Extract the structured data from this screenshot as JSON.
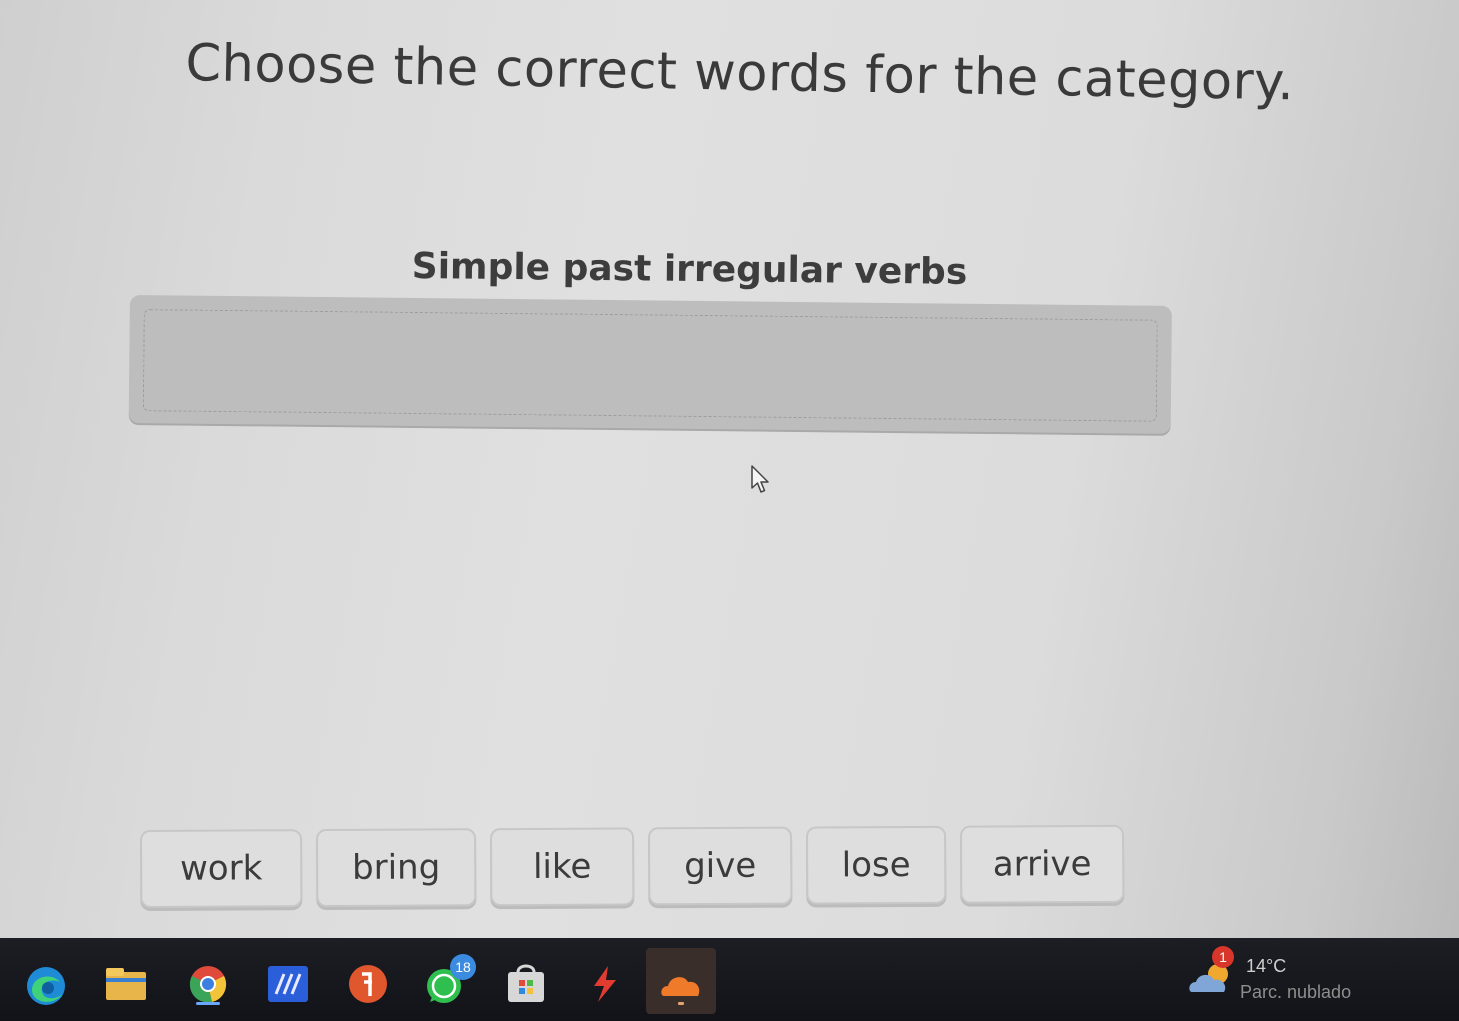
{
  "activity": {
    "instruction": "Choose the correct words for the category.",
    "category": "Simple past irregular verbs",
    "words": [
      "work",
      "bring",
      "like",
      "give",
      "lose",
      "arrive"
    ]
  },
  "taskbar": {
    "apps": [
      {
        "name": "edge-icon"
      },
      {
        "name": "file-explorer-icon"
      },
      {
        "name": "chrome-icon"
      },
      {
        "name": "app-blue-icon"
      },
      {
        "name": "app-red-circle-icon"
      },
      {
        "name": "whatsapp-icon",
        "badge": "18"
      },
      {
        "name": "store-icon"
      },
      {
        "name": "red-bolt-icon"
      },
      {
        "name": "cloud-app-icon"
      }
    ],
    "weather": {
      "badge": "1",
      "temperature": "14°C",
      "condition": "Parc. nublado"
    }
  },
  "colors": {
    "tile_bg": "#dedede",
    "dropzone_bg": "#bdbdbd",
    "taskbar_bg": "#15161b"
  }
}
